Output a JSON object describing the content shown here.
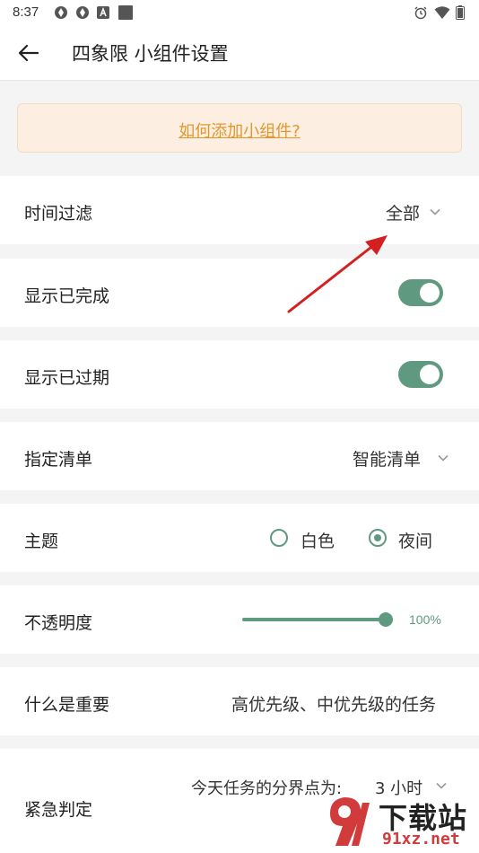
{
  "status_bar": {
    "time": "8:37"
  },
  "app_bar": {
    "title": "四象限 小组件设置"
  },
  "help": {
    "link_text": "如何添加小组件?"
  },
  "rows": {
    "time_filter": {
      "label": "时间过滤",
      "value": "全部"
    },
    "show_completed": {
      "label": "显示已完成",
      "on": true
    },
    "show_expired": {
      "label": "显示已过期",
      "on": true
    },
    "specify_list": {
      "label": "指定清单",
      "value": "智能清单"
    },
    "theme": {
      "label": "主题",
      "options": [
        "白色",
        "夜间"
      ],
      "selected": "夜间"
    },
    "opacity": {
      "label": "不透明度",
      "value_text": "100%",
      "value": 1.0
    },
    "what_is_important": {
      "label": "什么是重要",
      "value": "高优先级、中优先级的任务"
    },
    "urgency": {
      "label": "紧急判定",
      "boundary_text": "今天任务的分界点为:",
      "boundary_value": "3 小时"
    }
  },
  "watermark": {
    "line1": "下载站",
    "line2": "91xz.net"
  },
  "colors": {
    "accent": "#5f9a80",
    "link": "#e0982e",
    "banner_bg": "#fcefe1",
    "annotation_arrow": "#d42020"
  }
}
